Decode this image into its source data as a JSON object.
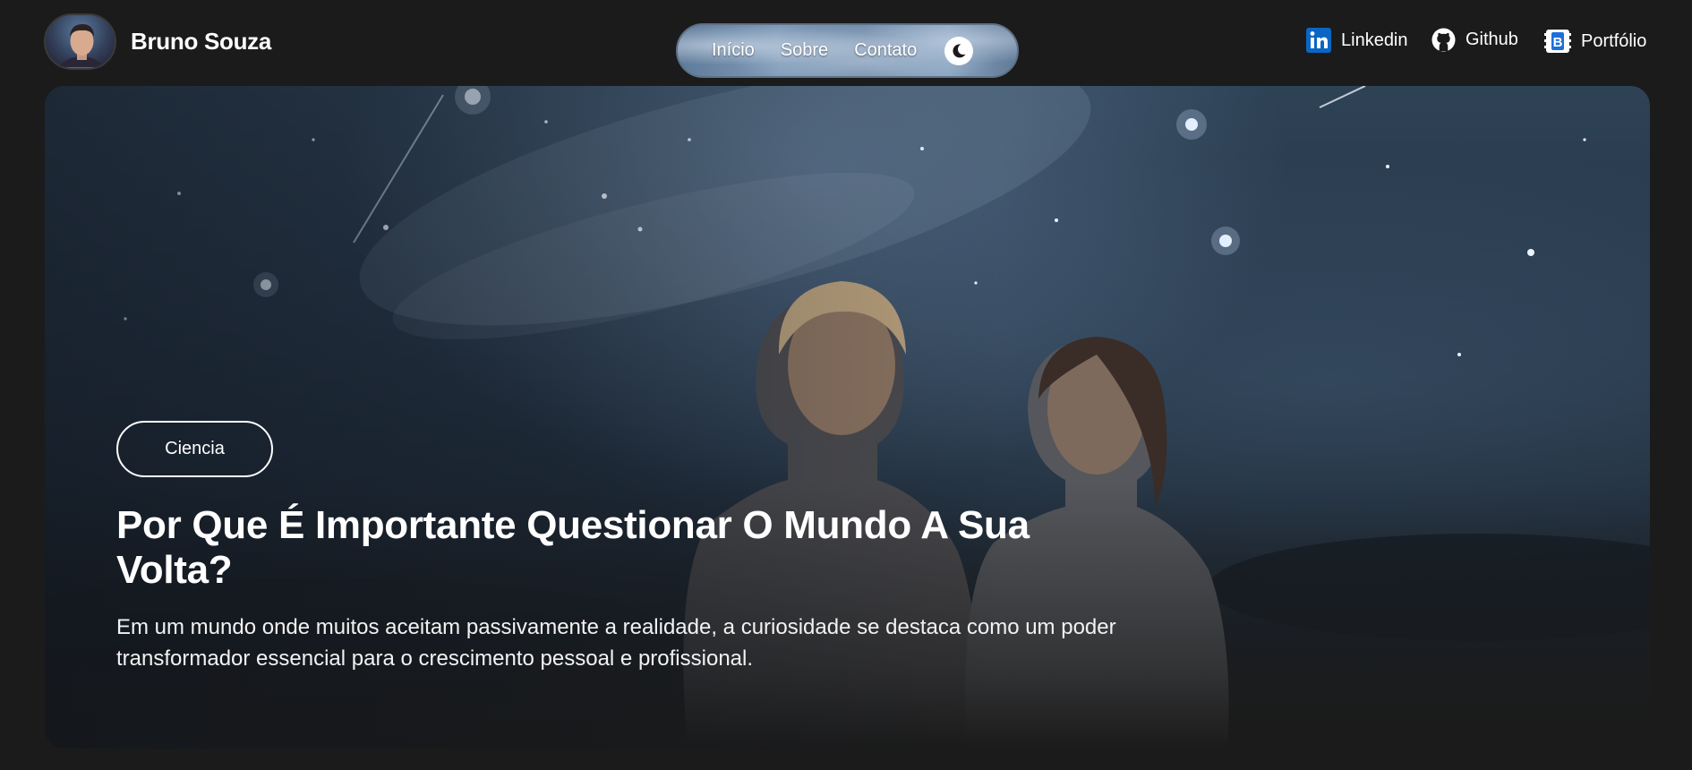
{
  "header": {
    "brand_name": "Bruno Souza",
    "nav": [
      "Início",
      "Sobre",
      "Contato"
    ],
    "social": [
      {
        "label": "Linkedin",
        "icon": "linkedin-icon"
      },
      {
        "label": "Github",
        "icon": "github-icon"
      },
      {
        "label": "Portfólio",
        "icon": "portfolio-icon"
      }
    ],
    "theme_toggle_icon": "moon-icon"
  },
  "hero": {
    "category": "Ciencia",
    "title": "Por Que É Importante Questionar O Mundo A Sua Volta?",
    "description": "Em um mundo onde muitos aceitam passivamente a realidade, a curiosidade se destaca como um poder transformador essencial para o crescimento pessoal e profissional."
  },
  "colors": {
    "page_background": "#1b1b1b",
    "text": "#ffffff",
    "linkedin": "#0a66c2",
    "portfolio": "#1e6fd9"
  }
}
